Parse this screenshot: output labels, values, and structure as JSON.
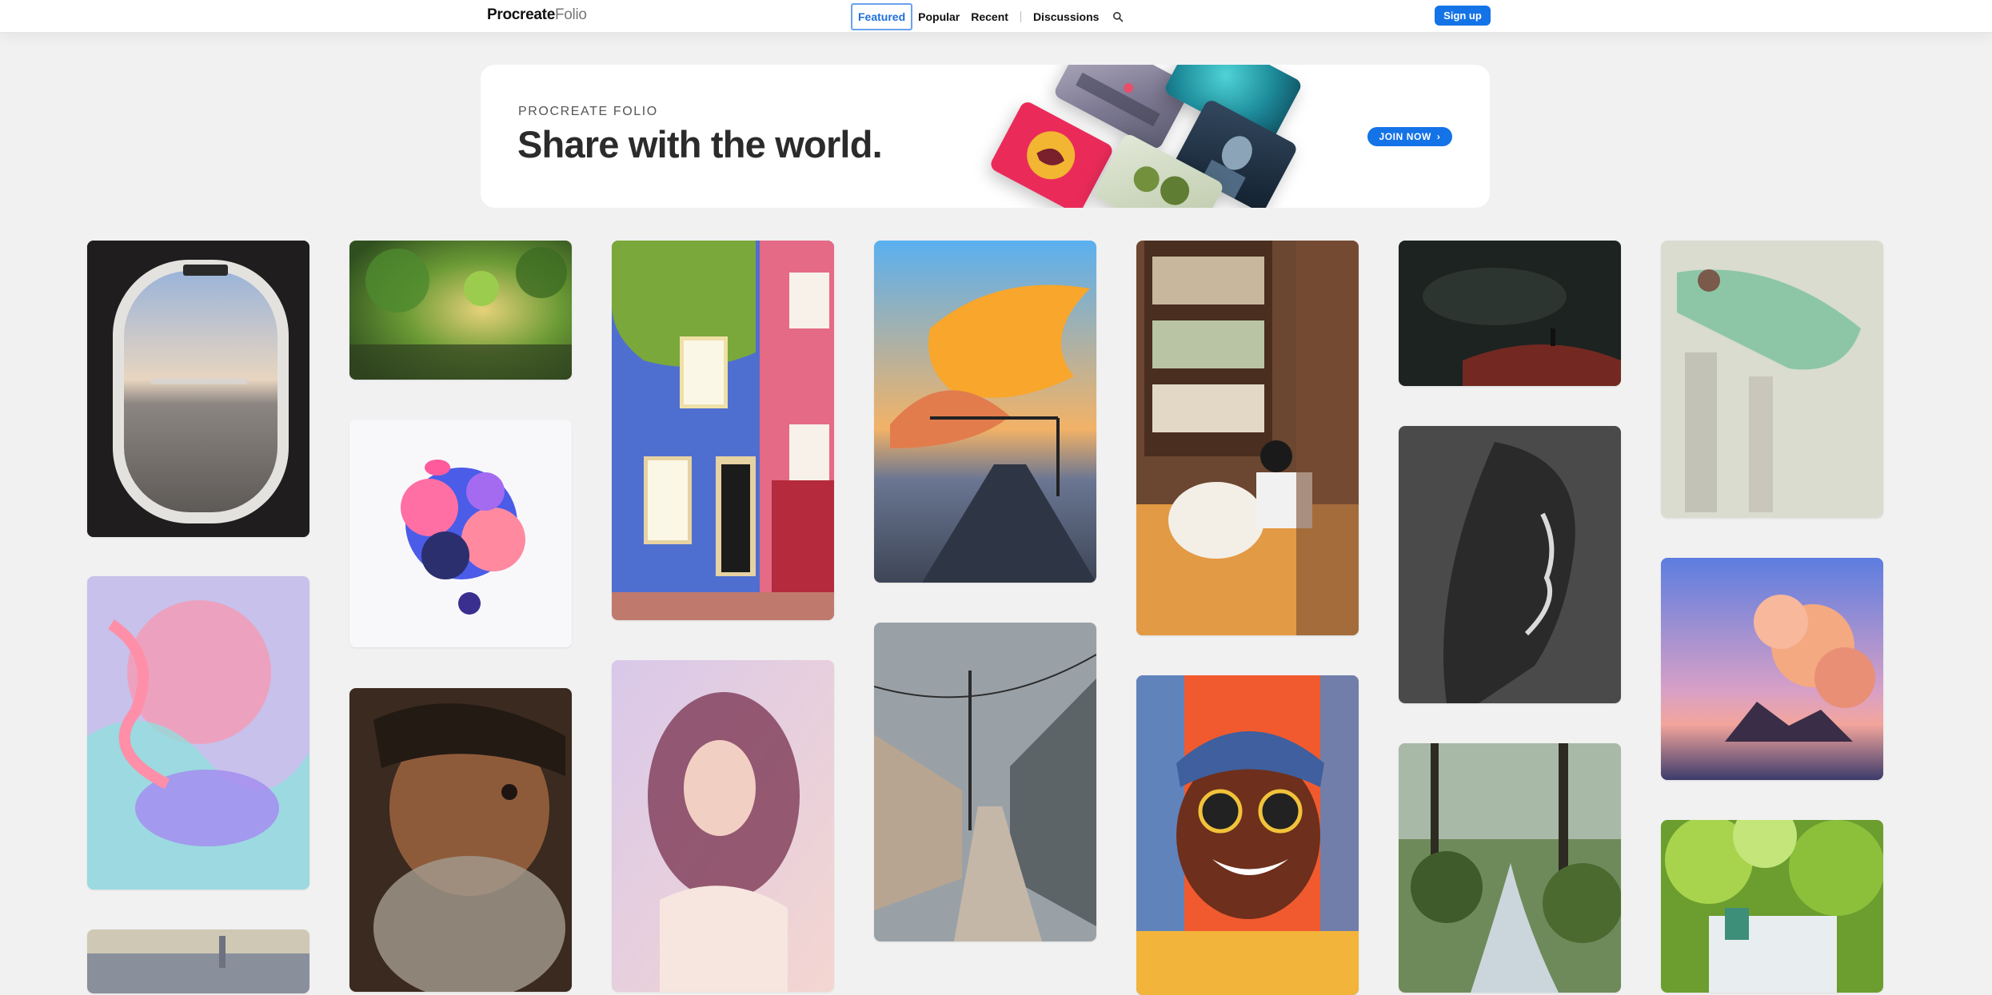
{
  "nav": {
    "logo_bold": "Procreate",
    "logo_light": "Folio",
    "tabs": [
      {
        "label": "Featured",
        "active": true
      },
      {
        "label": "Popular",
        "active": false
      },
      {
        "label": "Recent",
        "active": false
      },
      {
        "label": "Discussions",
        "active": false
      }
    ],
    "search_icon": "search-icon",
    "signup_label": "Sign up"
  },
  "banner": {
    "eyebrow": "PROCREATE FOLIO",
    "headline": "Share with the world.",
    "cta_label": "JOIN NOW",
    "cta_icon": "chevron-right-icon"
  },
  "colors": {
    "accent": "#1473e6",
    "background": "#f1f1f1",
    "active_tab_text": "#1e6fdc"
  }
}
